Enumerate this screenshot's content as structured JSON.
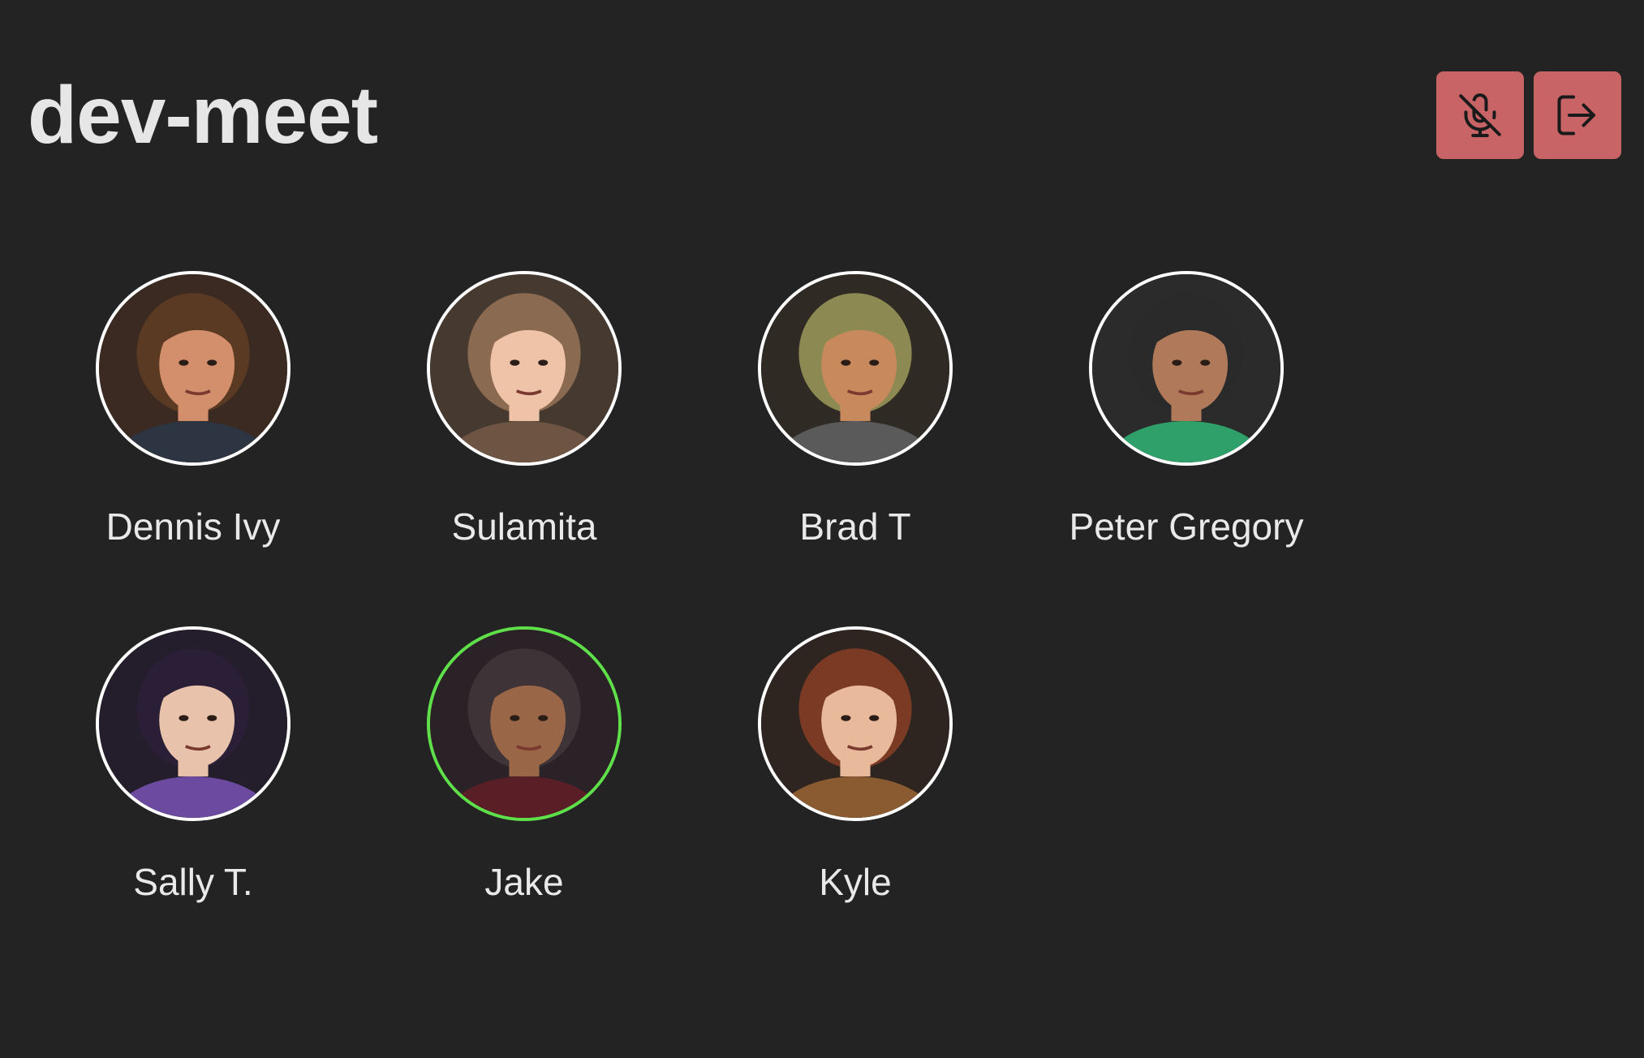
{
  "room": {
    "name": "dev-meet"
  },
  "controls": {
    "mic_icon": "mic-off-icon",
    "leave_icon": "log-out-icon",
    "button_color": "#c86465"
  },
  "speaking_color": "#5fe04a",
  "members": [
    {
      "name": "Dennis Ivy",
      "speaking": false,
      "skin": "#d38f6b",
      "hair": "#5a3a22",
      "cloth": "#2d3442",
      "bg": "#3b2a22"
    },
    {
      "name": "Sulamita",
      "speaking": false,
      "skin": "#efc3a8",
      "hair": "#8a6a50",
      "cloth": "#6e5442",
      "bg": "#463a30"
    },
    {
      "name": "Brad T",
      "speaking": false,
      "skin": "#c8895c",
      "hair": "#8c8a52",
      "cloth": "#5a5a5a",
      "bg": "#2f2a24"
    },
    {
      "name": "Peter Gregory",
      "speaking": false,
      "skin": "#b07a5a",
      "hair": "#2a2a2a",
      "cloth": "#2fa06a",
      "bg": "#2b2b2b"
    },
    {
      "name": "Sally T.",
      "speaking": false,
      "skin": "#e8c2aa",
      "hair": "#2a1f36",
      "cloth": "#6c4aa0",
      "bg": "#241e2c"
    },
    {
      "name": "Jake",
      "speaking": true,
      "skin": "#9a6648",
      "hair": "#3e3438",
      "cloth": "#5a1e26",
      "bg": "#2a2226"
    },
    {
      "name": "Kyle",
      "speaking": false,
      "skin": "#e8b99a",
      "hair": "#7a3a24",
      "cloth": "#8a5a30",
      "bg": "#2e2420"
    }
  ]
}
